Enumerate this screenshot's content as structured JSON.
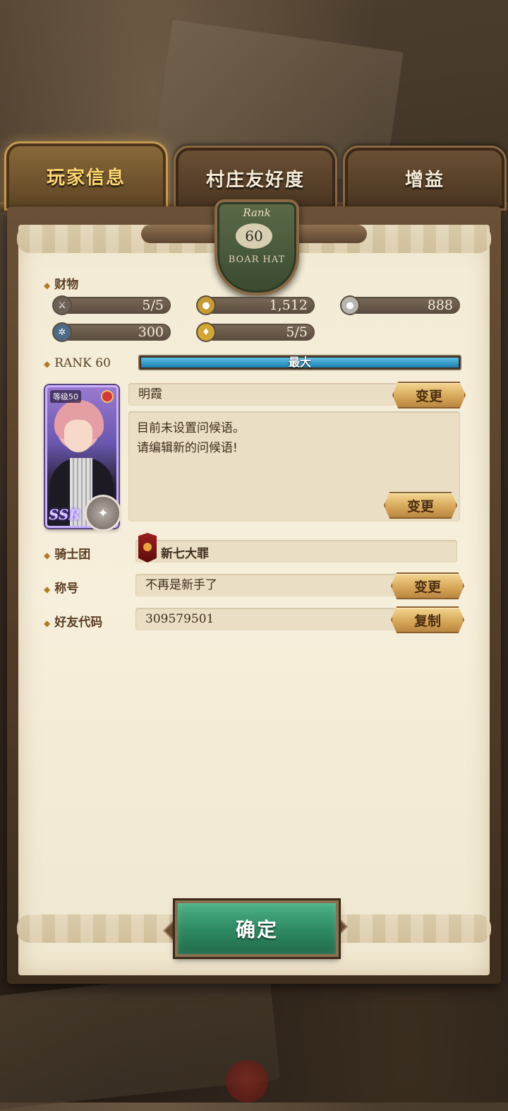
{
  "tabs": [
    {
      "label": "玩家信息",
      "active": true
    },
    {
      "label": "村庄友好度",
      "active": false
    },
    {
      "label": "增益",
      "active": false
    }
  ],
  "rank_badge": {
    "word": "Rank",
    "number": "60",
    "name": "BOAR HAT"
  },
  "resources": {
    "label": "财物",
    "items": [
      {
        "icon": "swords-icon",
        "value": "5/5"
      },
      {
        "icon": "gold-coin-icon",
        "value": "1,512"
      },
      {
        "icon": "silver-coin-icon",
        "value": "888"
      },
      {
        "icon": "gear-token-icon",
        "value": "300"
      },
      {
        "icon": "bell-icon",
        "value": "5/5"
      }
    ]
  },
  "rank": {
    "label": "RANK 60",
    "bar_text": "最大",
    "progress": 1.0
  },
  "profile": {
    "card_level": "等级50",
    "card_rarity": "SSR",
    "name": "明霞",
    "name_button": "变更",
    "greeting_line1": "目前未设置问候语。",
    "greeting_line2": "请编辑新的问候语!",
    "greeting_button": "变更"
  },
  "knights": {
    "label": "骑士团",
    "value": "新七大罪"
  },
  "title": {
    "label": "称号",
    "value": "不再是新手了",
    "button": "变更"
  },
  "friend_code": {
    "label": "好友代码",
    "value": "309579501",
    "button": "复制"
  },
  "confirm_button": "确定",
  "colors": {
    "accent_gold": "#ffd870",
    "confirm_green": "#2f8c64",
    "rank_bar_blue": "#1d7fae"
  }
}
